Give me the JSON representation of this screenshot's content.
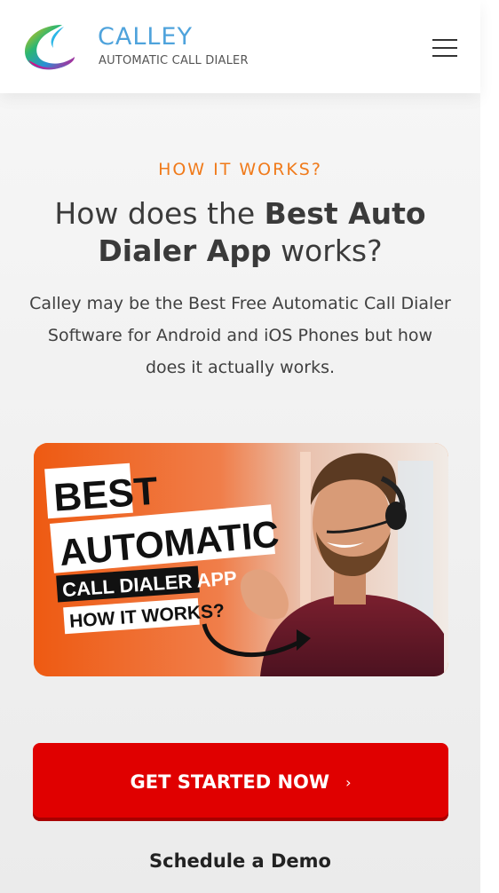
{
  "header": {
    "brand_title": "CALLEY",
    "brand_subtitle": "AUTOMATIC CALL DIALER"
  },
  "section": {
    "eyebrow": "HOW IT WORKS?",
    "heading_part1": "How does the ",
    "heading_bold": "Best Auto Dialer App",
    "heading_part2": " works?",
    "description": "Calley may be the Best Free Automatic Call Dialer Software for Android and iOS Phones but how does it actually works."
  },
  "video_thumbnail": {
    "line1": "BEST",
    "line2": "AUTOMATIC",
    "line3": "CALL DIALER APP",
    "line4": "HOW IT WORKS?"
  },
  "cta": {
    "primary_label": "GET STARTED NOW",
    "primary_chevron": "›",
    "secondary_label": "Schedule a Demo"
  },
  "colors": {
    "accent_orange": "#f07a1a",
    "brand_blue": "#4fa3dc",
    "cta_red": "#e00000"
  }
}
